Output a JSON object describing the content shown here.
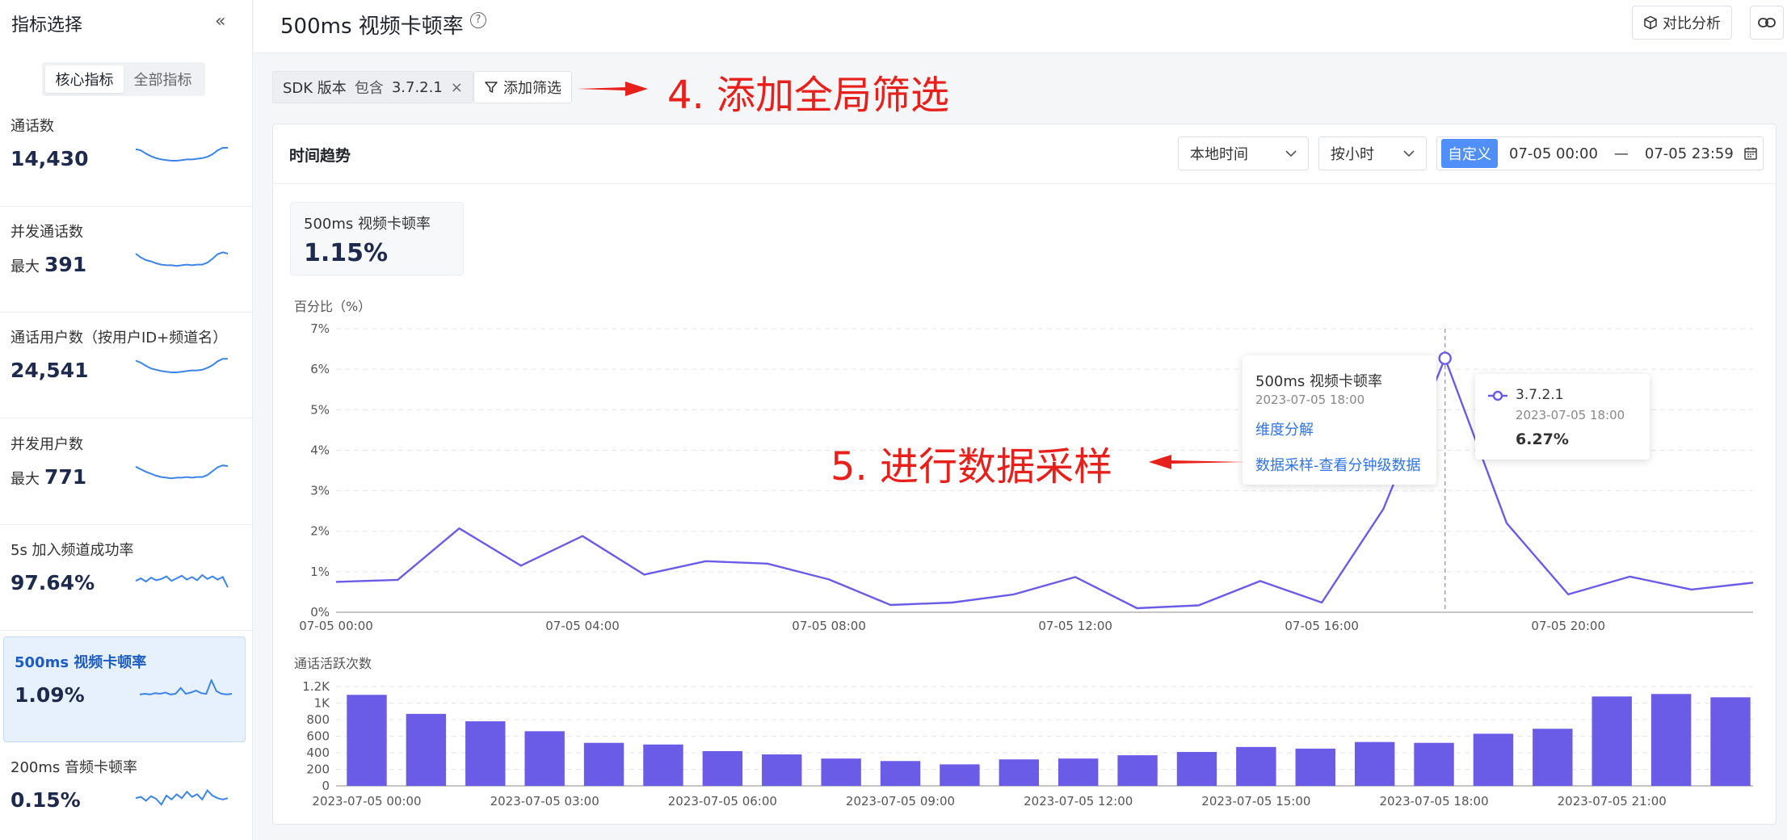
{
  "sidebar": {
    "title": "指标选择",
    "tabs": [
      "核心指标",
      "全部指标"
    ],
    "metrics": [
      {
        "label": "通话数",
        "prefix": "",
        "value": "14,430",
        "spark": [
          3.8,
          3.6,
          3.1,
          2.7,
          2.4,
          2.2,
          2.1,
          2.0,
          2.0,
          2.1,
          2.2,
          2.2,
          2.3,
          2.4,
          2.6,
          3.0,
          3.6,
          4.0,
          4.0
        ]
      },
      {
        "label": "并发通话数",
        "prefix": "最大",
        "value": "391",
        "spark": [
          4.0,
          3.4,
          3.0,
          2.8,
          2.5,
          2.3,
          2.2,
          2.2,
          2.1,
          2.2,
          2.3,
          2.2,
          2.3,
          2.3,
          2.6,
          3.2,
          3.9,
          4.2,
          4.0
        ]
      },
      {
        "label": "通话用户数（按用户ID+频道名）",
        "prefix": "",
        "value": "24,541",
        "spark": [
          3.8,
          3.5,
          3.0,
          2.6,
          2.4,
          2.2,
          2.1,
          2.0,
          2.0,
          2.1,
          2.2,
          2.3,
          2.3,
          2.4,
          2.7,
          3.1,
          3.7,
          4.1,
          4.1
        ]
      },
      {
        "label": "并发用户数",
        "prefix": "最大",
        "value": "771",
        "spark": [
          3.9,
          3.5,
          3.1,
          2.8,
          2.5,
          2.3,
          2.2,
          2.1,
          2.2,
          2.2,
          2.3,
          2.2,
          2.3,
          2.3,
          2.6,
          3.2,
          3.8,
          4.1,
          4.0
        ]
      },
      {
        "label": "5s 加入频道成功率",
        "prefix": "",
        "value": "97.64%",
        "spark": [
          2.6,
          3.0,
          2.5,
          3.1,
          2.7,
          2.9,
          3.3,
          2.6,
          3.0,
          3.4,
          2.8,
          3.2,
          2.7,
          3.5,
          2.9,
          3.3,
          2.8,
          3.2,
          1.6
        ]
      },
      {
        "label": "500ms 视频卡顿率",
        "prefix": "",
        "value": "1.09%",
        "spark": [
          2.4,
          2.5,
          2.4,
          2.6,
          2.5,
          2.7,
          2.4,
          2.5,
          3.4,
          2.5,
          2.7,
          3.0,
          2.6,
          2.5,
          4.6,
          2.9,
          2.5,
          2.4,
          2.5
        ]
      },
      {
        "label": "200ms 音频卡顿率",
        "prefix": "",
        "value": "0.15%",
        "spark": [
          2.6,
          2.8,
          2.2,
          2.9,
          2.5,
          1.6,
          3.0,
          2.4,
          3.2,
          2.6,
          3.6,
          2.8,
          3.2,
          2.4,
          3.8,
          3.0,
          2.6,
          2.4,
          2.6
        ]
      }
    ],
    "active_index": 5
  },
  "topbar": {
    "title": "500ms 视频卡顿率",
    "help_glyph": "?",
    "compare_label": "对比分析"
  },
  "filters": {
    "chip_key": "SDK 版本",
    "chip_op": "包含",
    "chip_value": "3.7.2.1",
    "add_label": "添加筛选"
  },
  "annotations": {
    "a4": "4. 添加全局筛选",
    "a5": "5. 进行数据采样"
  },
  "card": {
    "title": "时间趋势",
    "timezone": "本地时间",
    "granularity": "按小时",
    "custom_label": "自定义",
    "date_start": "07-05 00:00",
    "date_sep": "—",
    "date_end": "07-05 23:59",
    "kpi_label": "500ms 视频卡顿率",
    "kpi_value": "1.15%"
  },
  "tooltip_menu": {
    "title": "500ms 视频卡顿率",
    "time": "2023-07-05 18:00",
    "action1": "维度分解",
    "action2": "数据采样-查看分钟级数据"
  },
  "tooltip_point": {
    "series": "3.7.2.1",
    "time": "2023-07-05 18:00",
    "value": "6.27%"
  },
  "colors": {
    "accent": "#6b5ce7",
    "link": "#2f74e8",
    "annotation": "#e8201c"
  },
  "chart_data": [
    {
      "type": "line",
      "ylabel": "百分比（%）",
      "y_ticks": [
        "0%",
        "1%",
        "2%",
        "3%",
        "4%",
        "5%",
        "6%",
        "7%"
      ],
      "ylim": [
        0,
        7
      ],
      "x_ticks": [
        "07-05 00:00",
        "07-05 04:00",
        "07-05 08:00",
        "07-05 12:00",
        "07-05 16:00",
        "07-05 20:00"
      ],
      "x": [
        "00:00",
        "01:00",
        "02:00",
        "03:00",
        "04:00",
        "05:00",
        "06:00",
        "07:00",
        "08:00",
        "09:00",
        "10:00",
        "11:00",
        "12:00",
        "13:00",
        "14:00",
        "15:00",
        "16:00",
        "17:00",
        "18:00",
        "19:00",
        "20:00",
        "21:00",
        "22:00",
        "23:00"
      ],
      "series": [
        {
          "name": "3.7.2.1",
          "values": [
            0.75,
            0.8,
            2.07,
            1.15,
            1.88,
            0.93,
            1.26,
            1.2,
            0.81,
            0.18,
            0.24,
            0.44,
            0.87,
            0.1,
            0.17,
            0.77,
            0.24,
            2.55,
            6.27,
            2.2,
            0.44,
            0.88,
            0.56,
            0.73
          ]
        }
      ]
    },
    {
      "type": "bar",
      "ylabel": "通话活跃次数",
      "y_ticks": [
        "0",
        "200",
        "400",
        "600",
        "800",
        "1K",
        "1.2K"
      ],
      "ylim": [
        0,
        1200
      ],
      "x_ticks": [
        "2023-07-05 00:00",
        "2023-07-05 03:00",
        "2023-07-05 06:00",
        "2023-07-05 09:00",
        "2023-07-05 12:00",
        "2023-07-05 15:00",
        "2023-07-05 18:00",
        "2023-07-05 21:00"
      ],
      "values": [
        1100,
        870,
        780,
        660,
        520,
        500,
        420,
        380,
        330,
        300,
        260,
        320,
        330,
        370,
        410,
        470,
        450,
        530,
        520,
        630,
        690,
        1080,
        1110,
        1070
      ]
    }
  ]
}
